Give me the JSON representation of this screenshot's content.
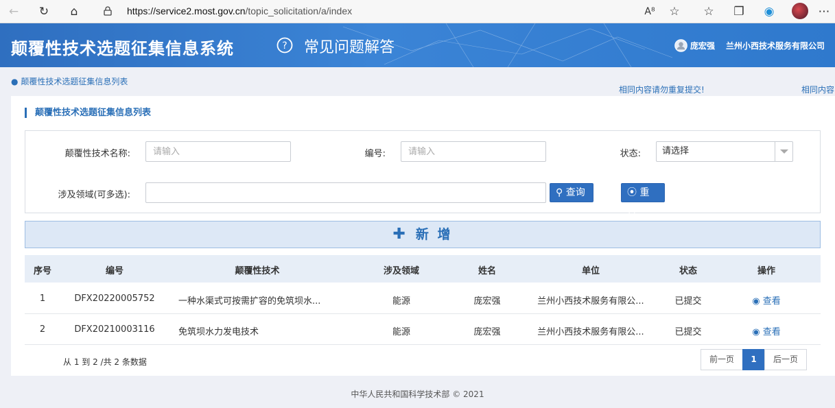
{
  "browser": {
    "url_host": "https://service2.most.gov.cn",
    "url_path": "/topic_solicitation/a/index"
  },
  "header": {
    "title": "颠覆性技术选题征集信息系统",
    "faq": "常见问题解答",
    "user_name": "庞宏强",
    "company": "兰州小西技术服务有限公司"
  },
  "breadcrumb": "颠覆性技术选题征集信息列表",
  "notices": [
    "相同内容请勿重复提交!",
    "相同内容"
  ],
  "panel_title": "颠覆性技术选题征集信息列表",
  "search": {
    "name_label": "颠覆性技术名称:",
    "name_placeholder": "请输入",
    "code_label": "编号:",
    "code_placeholder": "请输入",
    "status_label": "状态:",
    "status_value": "请选择",
    "domain_label": "涉及领域(可多选):",
    "query_label": "查询",
    "reset_label": "重置"
  },
  "add_label": "新 增",
  "table": {
    "headers": [
      "序号",
      "编号",
      "颠覆性技术",
      "涉及领域",
      "姓名",
      "单位",
      "状态",
      "操作"
    ],
    "rows": [
      [
        "1",
        "DFX20220005752",
        "一种水渠式可按需扩容的免筑坝水...",
        "能源",
        "庞宏强",
        "兰州小西技术服务有限公...",
        "已提交",
        "查看"
      ],
      [
        "2",
        "DFX20210003116",
        "免筑坝水力发电技术",
        "能源",
        "庞宏强",
        "兰州小西技术服务有限公...",
        "已提交",
        "查看"
      ]
    ]
  },
  "summary": "从 1 到 2 /共 2 条数据",
  "pagination": {
    "prev": "前一页",
    "current": "1",
    "next": "后一页"
  },
  "footer": "中华人民共和国科学技术部 © 2021",
  "colors": {
    "primary": "#2f6fc0",
    "link": "#2a6fb7",
    "header_bg": "#3b84d6"
  }
}
